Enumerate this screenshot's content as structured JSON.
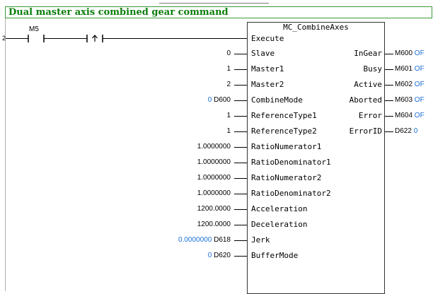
{
  "title": "Dual master axis combined gear command",
  "rung_number": "2",
  "contacts": [
    {
      "device": "M5",
      "type": "normally-open"
    },
    {
      "type": "rising-edge-pulse"
    }
  ],
  "function_block": {
    "name": "MC_CombineAxes",
    "execute_label": "Execute",
    "inputs": [
      {
        "pin": "Slave",
        "value": "0",
        "device": "",
        "monitor": ""
      },
      {
        "pin": "Master1",
        "value": "1",
        "device": "",
        "monitor": ""
      },
      {
        "pin": "Master2",
        "value": "2",
        "device": "",
        "monitor": ""
      },
      {
        "pin": "CombineMode",
        "value": "",
        "device": "D600",
        "monitor": "0"
      },
      {
        "pin": "ReferenceType1",
        "value": "1",
        "device": "",
        "monitor": ""
      },
      {
        "pin": "ReferenceType2",
        "value": "1",
        "device": "",
        "monitor": ""
      },
      {
        "pin": "RatioNumerator1",
        "value": "1.0000000",
        "device": "",
        "monitor": ""
      },
      {
        "pin": "RatioDenominator1",
        "value": "1.0000000",
        "device": "",
        "monitor": ""
      },
      {
        "pin": "RatioNumerator2",
        "value": "1.0000000",
        "device": "",
        "monitor": ""
      },
      {
        "pin": "RatioDenominator2",
        "value": "1.0000000",
        "device": "",
        "monitor": ""
      },
      {
        "pin": "Acceleration",
        "value": "1200.0000",
        "device": "",
        "monitor": ""
      },
      {
        "pin": "Deceleration",
        "value": "1200.0000",
        "device": "",
        "monitor": ""
      },
      {
        "pin": "Jerk",
        "value": "",
        "device": "D618",
        "monitor": "0.0000000"
      },
      {
        "pin": "BufferMode",
        "value": "",
        "device": "D620",
        "monitor": "0"
      }
    ],
    "outputs": [
      {
        "pin": "InGear",
        "device": "M600",
        "monitor": "OF"
      },
      {
        "pin": "Busy",
        "device": "M601",
        "monitor": "OF"
      },
      {
        "pin": "Active",
        "device": "M602",
        "monitor": "OF"
      },
      {
        "pin": "Aborted",
        "device": "M603",
        "monitor": "OF"
      },
      {
        "pin": "Error",
        "device": "M604",
        "monitor": "OF"
      },
      {
        "pin": "ErrorID",
        "device": "D622",
        "monitor": "0"
      }
    ]
  },
  "colors": {
    "title_text": "#0a7d0a",
    "title_border": "#3a9a3a",
    "monitor_value": "#1a6fd4",
    "wire": "#000000"
  }
}
